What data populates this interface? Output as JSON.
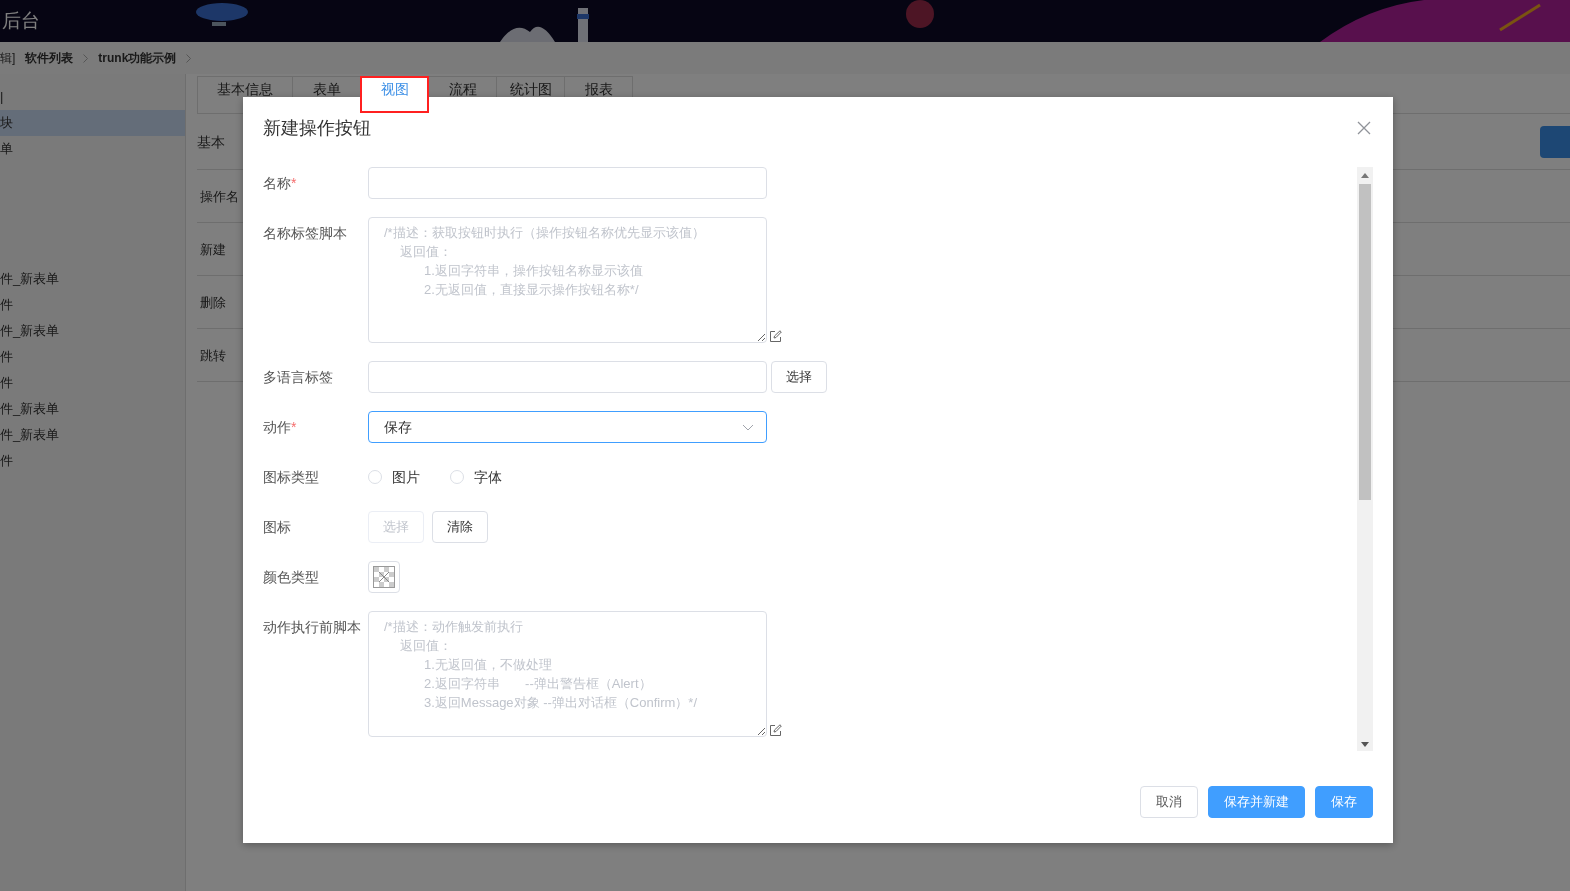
{
  "header": {
    "title": "后台"
  },
  "breadcrumb": [
    {
      "label": "辑]"
    },
    {
      "label": "软件列表"
    },
    {
      "label": "trunk功能示例"
    }
  ],
  "sidebar": {
    "items": [
      {
        "label": "|",
        "selected": false
      },
      {
        "label": "块",
        "selected": true
      },
      {
        "label": "单",
        "selected": false
      },
      {
        "label": "件_新表单",
        "selected": false
      },
      {
        "label": "件",
        "selected": false
      },
      {
        "label": "件_新表单",
        "selected": false
      },
      {
        "label": "件",
        "selected": false
      },
      {
        "label": "件",
        "selected": false
      },
      {
        "label": "件_新表单",
        "selected": false
      },
      {
        "label": "件_新表单",
        "selected": false
      },
      {
        "label": "件",
        "selected": false
      }
    ]
  },
  "tabs": [
    {
      "label": "基本信息",
      "selected": false,
      "highlighted": false
    },
    {
      "label": "表单",
      "selected": false,
      "highlighted": false
    },
    {
      "label": "视图",
      "selected": true,
      "highlighted": true
    },
    {
      "label": "流程",
      "selected": false,
      "highlighted": false
    },
    {
      "label": "统计图",
      "selected": false,
      "highlighted": false
    },
    {
      "label": "报表",
      "selected": false,
      "highlighted": false
    }
  ],
  "section_label": "基本",
  "table_rows": [
    {
      "label": "操作名"
    },
    {
      "label": "新建"
    },
    {
      "label": "删除"
    },
    {
      "label": "跳转"
    }
  ],
  "dialog": {
    "title": "新建操作按钮",
    "fields": [
      {
        "kind": "text",
        "label": "名称",
        "required_mark": "*"
      },
      {
        "kind": "script",
        "label": "名称标签脚本",
        "placeholder_lines": [
          {
            "text": "/*描述：获取按钮时执行（操作按钮名称优先显示该值）",
            "children": [
              {
                "text": "返回值：",
                "children": [
                  {
                    "text": "1.返回字符串，操作按钮名称显示该值"
                  },
                  {
                    "text": "2.无返回值，直接显示操作按钮名称*/"
                  }
                ]
              }
            ]
          }
        ]
      },
      {
        "kind": "text_button",
        "label": "多语言标签",
        "button": "选择"
      },
      {
        "kind": "select",
        "label": "动作",
        "required_mark": "*",
        "value": "保存"
      },
      {
        "kind": "radio",
        "label": "图标类型",
        "options": [
          {
            "label": "图片",
            "checked": false
          },
          {
            "label": "字体",
            "checked": false
          }
        ]
      },
      {
        "kind": "buttons",
        "label": "图标",
        "buttons": [
          {
            "label": "选择",
            "disabled": true
          },
          {
            "label": "清除",
            "disabled": false
          }
        ]
      },
      {
        "kind": "color",
        "label": "颜色类型"
      },
      {
        "kind": "script",
        "label": "动作执行前脚本",
        "placeholder_lines": [
          {
            "text": "/*描述：动作触发前执行",
            "children": [
              {
                "text": "返回值：",
                "children": [
                  {
                    "text": "1.无返回值，不做处理"
                  },
                  {
                    "text": "2.返回字符串       --弹出警告框（Alert）"
                  },
                  {
                    "text": "3.返回Message对象 --弹出对话框（Confirm）*/"
                  }
                ]
              }
            ]
          }
        ]
      }
    ],
    "footer_buttons": [
      {
        "label": "取消",
        "kind": "default"
      },
      {
        "label": "保存并新建",
        "kind": "primary"
      },
      {
        "label": "保存",
        "kind": "primary"
      }
    ]
  }
}
